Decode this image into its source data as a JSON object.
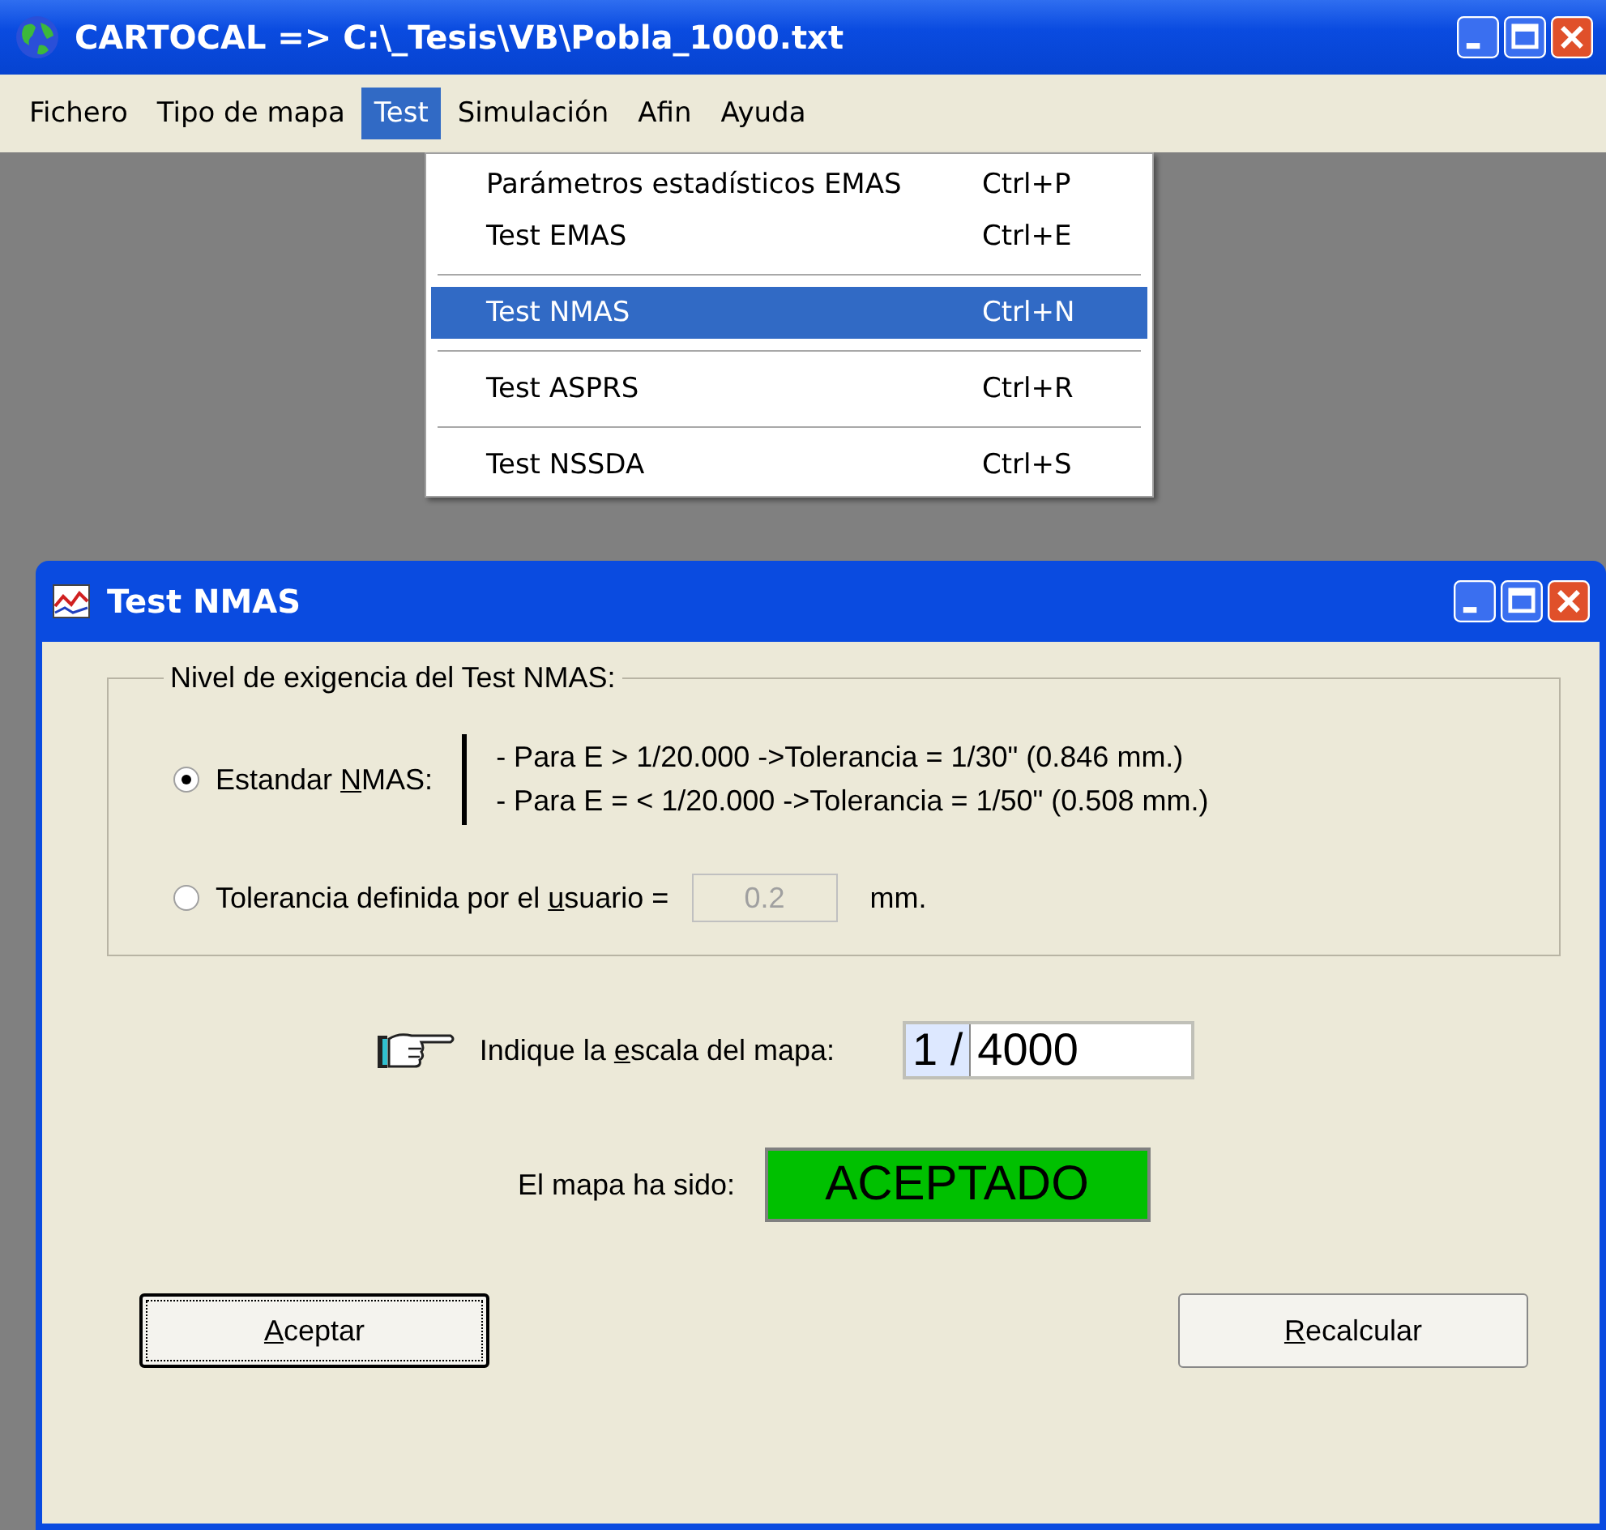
{
  "window": {
    "title": "CARTOCAL => C:\\_Tesis\\VB\\Pobla_1000.txt"
  },
  "menu_bar": [
    {
      "label": "Fichero",
      "selected": false
    },
    {
      "label": "Tipo de mapa",
      "selected": false
    },
    {
      "label": "Test",
      "selected": true
    },
    {
      "label": "Simulación",
      "selected": false
    },
    {
      "label": "Afin",
      "selected": false
    },
    {
      "label": "Ayuda",
      "selected": false
    }
  ],
  "menu": {
    "items": [
      {
        "kind": "item",
        "label": "Parámetros estadísticos EMAS",
        "shortcut": "Ctrl+P",
        "selected": false
      },
      {
        "kind": "item",
        "label": "Test EMAS",
        "shortcut": "Ctrl+E",
        "selected": false
      },
      {
        "kind": "separator"
      },
      {
        "kind": "item",
        "label": "Test NMAS",
        "shortcut": "Ctrl+N",
        "selected": true
      },
      {
        "kind": "separator"
      },
      {
        "kind": "item",
        "label": "Test ASPRS",
        "shortcut": "Ctrl+R",
        "selected": false
      },
      {
        "kind": "separator"
      },
      {
        "kind": "item",
        "label": "Test NSSDA",
        "shortcut": "Ctrl+S",
        "selected": false
      }
    ]
  },
  "dialog": {
    "title": "Test NMAS",
    "group_label": "Nivel de exigencia del Test NMAS:",
    "options": [
      {
        "kind": "standard",
        "selected": true,
        "label": [
          {
            "text": "Estandar "
          },
          {
            "text": "N",
            "underline": true
          },
          {
            "text": "MAS:"
          }
        ],
        "rules": [
          "- Para E > 1/20.000 ->Tolerancia = 1/30\"  (0.846 mm.)",
          "- Para E = < 1/20.000 ->Tolerancia = 1/50\"  (0.508 mm.)"
        ]
      },
      {
        "kind": "custom",
        "selected": false,
        "label": [
          {
            "text": "Tolerancia definida por el "
          },
          {
            "text": "u",
            "underline": true
          },
          {
            "text": "suario ="
          }
        ],
        "value": "0.2",
        "disabled": true,
        "unit": "mm."
      }
    ],
    "scale": {
      "label": [
        {
          "text": "Indique la "
        },
        {
          "text": "e",
          "underline": true
        },
        {
          "text": "scala del mapa:"
        }
      ],
      "prefix": "1 /",
      "value": "4000"
    },
    "result": {
      "label": "El mapa ha sido:",
      "value": "ACEPTADO",
      "accepted": true
    },
    "buttons": [
      {
        "label": [
          {
            "text": "A",
            "underline": true
          },
          {
            "text": "ceptar"
          }
        ],
        "focused": true
      },
      {
        "label": [
          {
            "text": "R",
            "underline": true
          },
          {
            "text": "ecalcular"
          }
        ],
        "focused": false
      }
    ]
  }
}
